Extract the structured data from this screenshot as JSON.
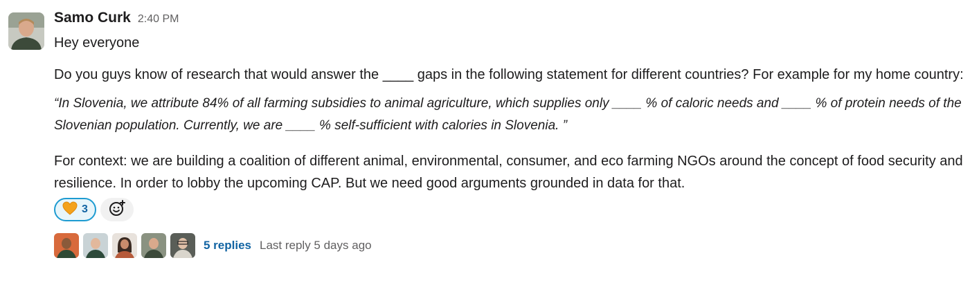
{
  "message": {
    "author": "Samo Curk",
    "timestamp": "2:40 PM",
    "greeting": "Hey everyone",
    "paragraph1": "Do you guys know of research that would answer the ____ gaps in the following statement for different countries? For example for my home country:",
    "quote": "“In Slovenia, we attribute 84% of all farming subsidies to animal agriculture, which supplies only ____ % of caloric needs and ____ % of protein needs of the Slovenian population. Currently, we are ____ % self-sufficient with calories in Slovenia. ”",
    "paragraph2": "For context: we are building a coalition of different animal, environmental, consumer, and eco farming NGOs around the concept of food security and resilience. In order to lobby the upcoming CAP. But we need good arguments grounded in data for that."
  },
  "reactions": [
    {
      "emoji": "orange-heart-icon",
      "count": "3"
    }
  ],
  "thread": {
    "reply_count_label": "5 replies",
    "last_reply_label": "Last reply 5 days ago",
    "avatar_colors": [
      "#d86a3c",
      "#9fb3b8",
      "#7d5a4a",
      "#6f7a63",
      "#8c8a82"
    ]
  },
  "colors": {
    "link": "#1264a3",
    "reaction_border": "#1d9bd1",
    "reaction_bg": "#e8f5fa",
    "muted": "#616061"
  }
}
